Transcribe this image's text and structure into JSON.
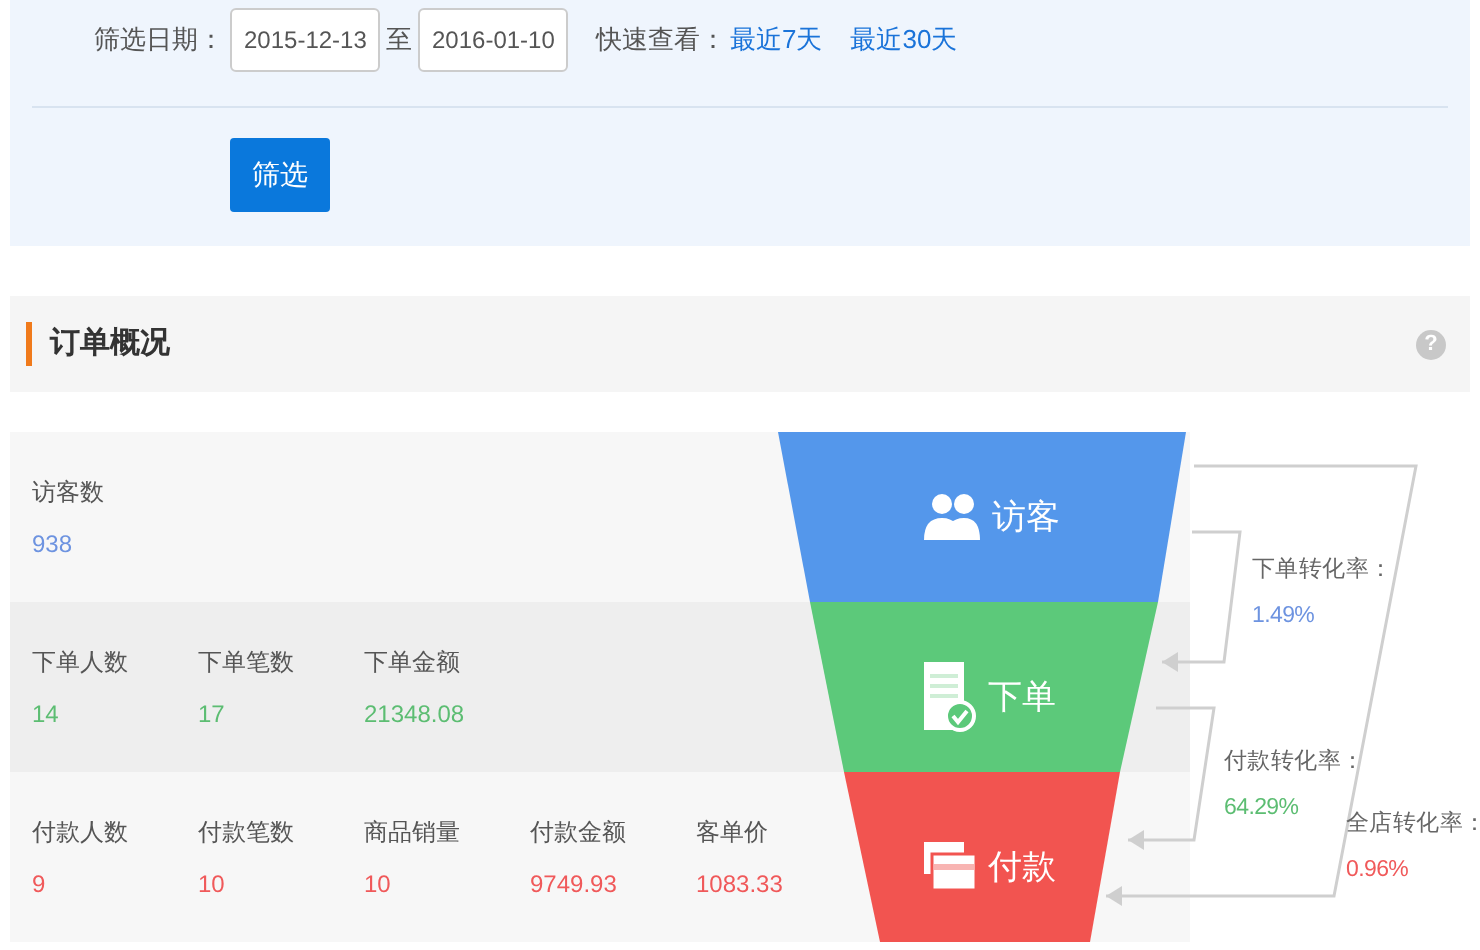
{
  "filter": {
    "label": "筛选日期：",
    "start_date": "2015-12-13",
    "separator": "至",
    "end_date": "2016-01-10",
    "quick_label": "快速查看：",
    "quick_links": [
      "最近7天",
      "最近30天"
    ],
    "submit": "筛选"
  },
  "section": {
    "title": "订单概况",
    "help": "?"
  },
  "stages": [
    {
      "label": "访客",
      "color": "#5497eb",
      "metrics": [
        {
          "label": "访客数",
          "value": "938"
        }
      ]
    },
    {
      "label": "下单",
      "color": "#5cc97a",
      "metrics": [
        {
          "label": "下单人数",
          "value": "14"
        },
        {
          "label": "下单笔数",
          "value": "17"
        },
        {
          "label": "下单金额",
          "value": "21348.08"
        }
      ]
    },
    {
      "label": "付款",
      "color": "#f25450",
      "metrics": [
        {
          "label": "付款人数",
          "value": "9"
        },
        {
          "label": "付款笔数",
          "value": "10"
        },
        {
          "label": "商品销量",
          "value": "10"
        },
        {
          "label": "付款金额",
          "value": "9749.93"
        },
        {
          "label": "客单价",
          "value": "1083.33"
        }
      ]
    }
  ],
  "rates": [
    {
      "label": "下单转化率：",
      "value": "1.49%",
      "color": "#6d93e0"
    },
    {
      "label": "付款转化率：",
      "value": "64.29%",
      "color": "#5cbd72"
    },
    {
      "label": "全店转化率：",
      "value": "0.96%",
      "color": "#f0595a"
    }
  ]
}
